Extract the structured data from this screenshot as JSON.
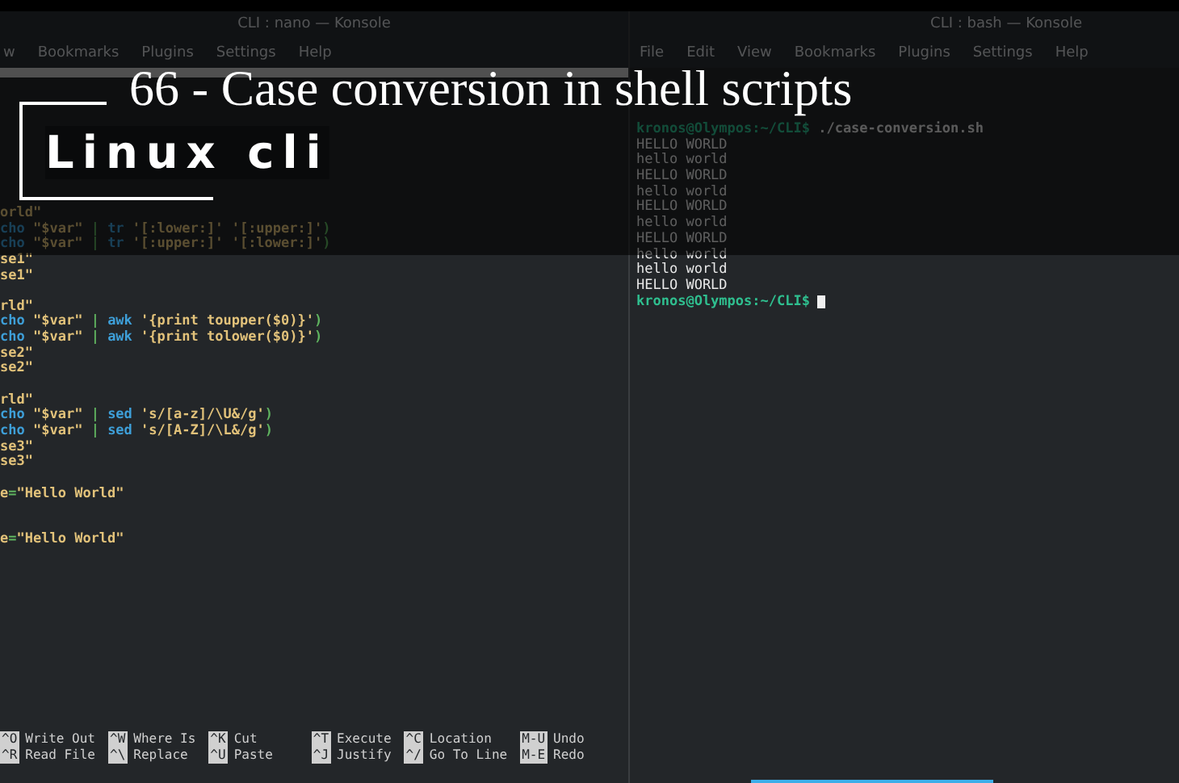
{
  "overlay": {
    "title": "66 - Case conversion in shell scripts",
    "logo": "Linux cli"
  },
  "left_window": {
    "title": "CLI : nano — Konsole",
    "menu": [
      "w",
      "Bookmarks",
      "Plugins",
      "Settings",
      "Help"
    ],
    "code_lines": [
      {
        "kind": "code",
        "segments": [
          {
            "text": "orld\"",
            "kind": "text"
          }
        ]
      },
      {
        "kind": "code",
        "segments": [
          {
            "text": "cho ",
            "kind": "command"
          },
          {
            "text": "\"$var\" ",
            "kind": "text"
          },
          {
            "text": "| ",
            "kind": "punct"
          },
          {
            "text": "tr ",
            "kind": "command"
          },
          {
            "text": "'[:lower:]' '[:upper:]'",
            "kind": "text"
          },
          {
            "text": ")",
            "kind": "punct"
          }
        ]
      },
      {
        "kind": "code",
        "segments": [
          {
            "text": "cho ",
            "kind": "command"
          },
          {
            "text": "\"$var\" ",
            "kind": "text"
          },
          {
            "text": "| ",
            "kind": "punct"
          },
          {
            "text": "tr ",
            "kind": "command"
          },
          {
            "text": "'[:upper:]' '[:lower:]'",
            "kind": "text"
          },
          {
            "text": ")",
            "kind": "punct"
          }
        ]
      },
      {
        "kind": "code",
        "segments": [
          {
            "text": "se1\"",
            "kind": "text"
          }
        ]
      },
      {
        "kind": "code",
        "segments": [
          {
            "text": "se1\"",
            "kind": "text"
          }
        ]
      },
      {
        "kind": "blank"
      },
      {
        "kind": "code",
        "segments": [
          {
            "text": "rld\"",
            "kind": "text"
          }
        ]
      },
      {
        "kind": "code",
        "segments": [
          {
            "text": "cho ",
            "kind": "command"
          },
          {
            "text": "\"$var\" ",
            "kind": "text"
          },
          {
            "text": "| ",
            "kind": "punct"
          },
          {
            "text": "awk ",
            "kind": "command"
          },
          {
            "text": "'{print toupper($0)}'",
            "kind": "text"
          },
          {
            "text": ")",
            "kind": "punct"
          }
        ]
      },
      {
        "kind": "code",
        "segments": [
          {
            "text": "cho ",
            "kind": "command"
          },
          {
            "text": "\"$var\" ",
            "kind": "text"
          },
          {
            "text": "| ",
            "kind": "punct"
          },
          {
            "text": "awk ",
            "kind": "command"
          },
          {
            "text": "'{print tolower($0)}'",
            "kind": "text"
          },
          {
            "text": ")",
            "kind": "punct"
          }
        ]
      },
      {
        "kind": "code",
        "segments": [
          {
            "text": "se2\"",
            "kind": "text"
          }
        ]
      },
      {
        "kind": "code",
        "segments": [
          {
            "text": "se2\"",
            "kind": "text"
          }
        ]
      },
      {
        "kind": "blank"
      },
      {
        "kind": "code",
        "segments": [
          {
            "text": "rld\"",
            "kind": "text"
          }
        ]
      },
      {
        "kind": "code",
        "segments": [
          {
            "text": "cho ",
            "kind": "command"
          },
          {
            "text": "\"$var\" ",
            "kind": "text"
          },
          {
            "text": "| ",
            "kind": "punct"
          },
          {
            "text": "sed ",
            "kind": "command"
          },
          {
            "text": "'s/[a-z]/\\U&/g'",
            "kind": "text"
          },
          {
            "text": ")",
            "kind": "punct"
          }
        ]
      },
      {
        "kind": "code",
        "segments": [
          {
            "text": "cho ",
            "kind": "command"
          },
          {
            "text": "\"$var\" ",
            "kind": "text"
          },
          {
            "text": "| ",
            "kind": "punct"
          },
          {
            "text": "sed ",
            "kind": "command"
          },
          {
            "text": "'s/[A-Z]/\\L&/g'",
            "kind": "text"
          },
          {
            "text": ")",
            "kind": "punct"
          }
        ]
      },
      {
        "kind": "code",
        "segments": [
          {
            "text": "se3\"",
            "kind": "text"
          }
        ]
      },
      {
        "kind": "code",
        "segments": [
          {
            "text": "se3\"",
            "kind": "text"
          }
        ]
      },
      {
        "kind": "blank"
      },
      {
        "kind": "code",
        "segments": [
          {
            "text": "e",
            "kind": "text"
          },
          {
            "text": "=",
            "kind": "punct"
          },
          {
            "text": "\"Hello World\"",
            "kind": "text"
          }
        ]
      },
      {
        "kind": "blank"
      },
      {
        "kind": "blank"
      },
      {
        "kind": "code",
        "segments": [
          {
            "text": "e",
            "kind": "text"
          },
          {
            "text": "=",
            "kind": "punct"
          },
          {
            "text": "\"Hello World\"",
            "kind": "text"
          }
        ]
      }
    ],
    "shortcuts": [
      [
        {
          "key": "^O",
          "label": "Write Out"
        },
        {
          "key": "^R",
          "label": "Read File"
        }
      ],
      [
        {
          "key": "^W",
          "label": "Where Is"
        },
        {
          "key": "^\\",
          "label": "Replace"
        }
      ],
      [
        {
          "key": "^K",
          "label": "Cut"
        },
        {
          "key": "^U",
          "label": "Paste"
        }
      ],
      [
        {
          "key": "^T",
          "label": "Execute"
        },
        {
          "key": "^J",
          "label": "Justify"
        }
      ],
      [
        {
          "key": "^C",
          "label": "Location"
        },
        {
          "key": "^/",
          "label": "Go To Line"
        }
      ],
      [
        {
          "key": "M-U",
          "label": "Undo"
        },
        {
          "key": "M-E",
          "label": "Redo"
        }
      ]
    ]
  },
  "right_window": {
    "title": "CLI : bash — Konsole",
    "menu": [
      "File",
      "Edit",
      "View",
      "Bookmarks",
      "Plugins",
      "Settings",
      "Help"
    ],
    "lines": [
      {
        "kind": "prompt",
        "prompt": "kronos@Olympos:~/CLI$",
        "command": " ./case-conversion.sh"
      },
      {
        "kind": "output",
        "text": "HELLO WORLD"
      },
      {
        "kind": "output",
        "text": "hello world"
      },
      {
        "kind": "output",
        "text": "HELLO WORLD"
      },
      {
        "kind": "output",
        "text": "hello world"
      },
      {
        "kind": "output",
        "text": "HELLO WORLD"
      },
      {
        "kind": "output",
        "text": "hello world"
      },
      {
        "kind": "output",
        "text": "HELLO WORLD"
      },
      {
        "kind": "output",
        "text": "hello world"
      },
      {
        "kind": "output",
        "text": "hello world"
      },
      {
        "kind": "output",
        "text": "HELLO WORLD"
      },
      {
        "kind": "cursor_prompt",
        "prompt": "kronos@Olympos:~/CLI$"
      }
    ]
  }
}
